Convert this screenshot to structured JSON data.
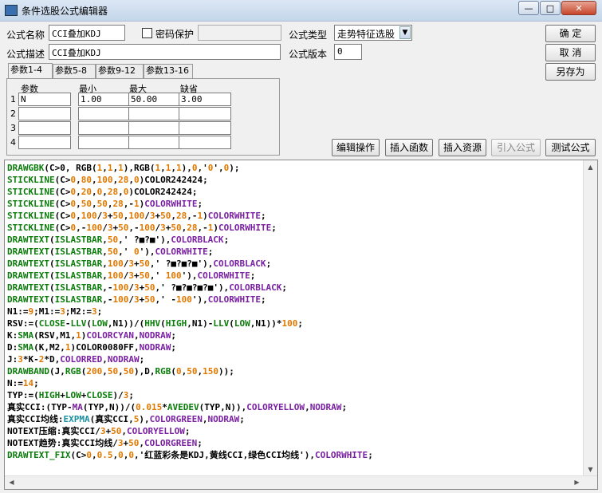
{
  "window": {
    "title": "条件选股公式编辑器",
    "minimize": "—",
    "maximize": "□",
    "close": "✕"
  },
  "form": {
    "name_label": "公式名称",
    "name_value": "CCI叠加KDJ",
    "password_label": "密码保护",
    "password_value": "",
    "type_label": "公式类型",
    "type_value": "走势特征选股",
    "desc_label": "公式描述",
    "desc_value": "CCI叠加KDJ",
    "version_label": "公式版本",
    "version_value": "0"
  },
  "buttons": {
    "ok": "确  定",
    "cancel": "取  消",
    "save_as": "另存为",
    "edit_op": "编辑操作",
    "insert_func": "插入函数",
    "insert_res": "插入资源",
    "import_formula": "引入公式",
    "test_formula": "测试公式"
  },
  "tabs": [
    "参数1-4",
    "参数5-8",
    "参数9-12",
    "参数13-16"
  ],
  "params": {
    "headers": [
      "参数",
      "最小",
      "最大",
      "缺省"
    ],
    "rows": [
      {
        "num": "1",
        "name": "N",
        "min": "1.00",
        "max": "50.00",
        "def": "3.00"
      },
      {
        "num": "2",
        "name": "",
        "min": "",
        "max": "",
        "def": ""
      },
      {
        "num": "3",
        "name": "",
        "min": "",
        "max": "",
        "def": ""
      },
      {
        "num": "4",
        "name": "",
        "min": "",
        "max": "",
        "def": ""
      }
    ]
  },
  "colors": {
    "func_green": "#0a7d0a",
    "keyword_purple": "#7a1fa2",
    "number_orange": "#e07800",
    "cyan_func": "#1a8fa0",
    "text_black": "#000000"
  },
  "code_lines": [
    [
      [
        "DRAWGBK",
        "g"
      ],
      [
        "(C>0, RGB(",
        "k"
      ],
      [
        "1",
        "o"
      ],
      [
        ",",
        "k"
      ],
      [
        "1",
        "o"
      ],
      [
        ",",
        "k"
      ],
      [
        "1",
        "o"
      ],
      [
        "),RGB(",
        "k"
      ],
      [
        "1",
        "o"
      ],
      [
        ",",
        "k"
      ],
      [
        "1",
        "o"
      ],
      [
        ",",
        "k"
      ],
      [
        "1",
        "o"
      ],
      [
        "),",
        "k"
      ],
      [
        "0",
        "o"
      ],
      [
        ",'",
        "k"
      ],
      [
        "0",
        "o"
      ],
      [
        "',",
        "k"
      ],
      [
        "0",
        "o"
      ],
      [
        ");",
        "k"
      ]
    ],
    [
      [
        "STICKLINE",
        "g"
      ],
      [
        "(C>",
        "k"
      ],
      [
        "0",
        "o"
      ],
      [
        ",",
        "k"
      ],
      [
        "80",
        "o"
      ],
      [
        ",",
        "k"
      ],
      [
        "100",
        "o"
      ],
      [
        ",",
        "k"
      ],
      [
        "28",
        "o"
      ],
      [
        ",",
        "k"
      ],
      [
        "0",
        "o"
      ],
      [
        ")COLOR242424;",
        "k"
      ]
    ],
    [
      [
        "STICKLINE",
        "g"
      ],
      [
        "(C>",
        "k"
      ],
      [
        "0",
        "o"
      ],
      [
        ",",
        "k"
      ],
      [
        "20",
        "o"
      ],
      [
        ",",
        "k"
      ],
      [
        "0",
        "o"
      ],
      [
        ",",
        "k"
      ],
      [
        "28",
        "o"
      ],
      [
        ",",
        "k"
      ],
      [
        "0",
        "o"
      ],
      [
        ")COLOR242424;",
        "k"
      ]
    ],
    [
      [
        "STICKLINE",
        "g"
      ],
      [
        "(C>",
        "k"
      ],
      [
        "0",
        "o"
      ],
      [
        ",",
        "k"
      ],
      [
        "50",
        "o"
      ],
      [
        ",",
        "k"
      ],
      [
        "50",
        "o"
      ],
      [
        ",",
        "k"
      ],
      [
        "28",
        "o"
      ],
      [
        ",-",
        "k"
      ],
      [
        "1",
        "o"
      ],
      [
        ")",
        "k"
      ],
      [
        "COLORWHITE",
        "p"
      ],
      [
        ";",
        "k"
      ]
    ],
    [
      [
        "STICKLINE",
        "g"
      ],
      [
        "(C>",
        "k"
      ],
      [
        "0",
        "o"
      ],
      [
        ",",
        "k"
      ],
      [
        "100",
        "o"
      ],
      [
        "/",
        "k"
      ],
      [
        "3",
        "o"
      ],
      [
        "+",
        "k"
      ],
      [
        "50",
        "o"
      ],
      [
        ",",
        "k"
      ],
      [
        "100",
        "o"
      ],
      [
        "/",
        "k"
      ],
      [
        "3",
        "o"
      ],
      [
        "+",
        "k"
      ],
      [
        "50",
        "o"
      ],
      [
        ",",
        "k"
      ],
      [
        "28",
        "o"
      ],
      [
        ",-",
        "k"
      ],
      [
        "1",
        "o"
      ],
      [
        ")",
        "k"
      ],
      [
        "COLORWHITE",
        "p"
      ],
      [
        ";",
        "k"
      ]
    ],
    [
      [
        "STICKLINE",
        "g"
      ],
      [
        "(C>",
        "k"
      ],
      [
        "0",
        "o"
      ],
      [
        ",-",
        "k"
      ],
      [
        "100",
        "o"
      ],
      [
        "/",
        "k"
      ],
      [
        "3",
        "o"
      ],
      [
        "+",
        "k"
      ],
      [
        "50",
        "o"
      ],
      [
        ",-",
        "k"
      ],
      [
        "100",
        "o"
      ],
      [
        "/",
        "k"
      ],
      [
        "3",
        "o"
      ],
      [
        "+",
        "k"
      ],
      [
        "50",
        "o"
      ],
      [
        ",",
        "k"
      ],
      [
        "28",
        "o"
      ],
      [
        ",-",
        "k"
      ],
      [
        "1",
        "o"
      ],
      [
        ")",
        "k"
      ],
      [
        "COLORWHITE",
        "p"
      ],
      [
        ";",
        "k"
      ]
    ],
    [
      [
        "DRAWTEXT",
        "g"
      ],
      [
        "(",
        "k"
      ],
      [
        "ISLASTBAR",
        "g"
      ],
      [
        ",",
        "k"
      ],
      [
        "50",
        "o"
      ],
      [
        ",' ?■?■'),",
        "k"
      ],
      [
        "COLORBLACK",
        "p"
      ],
      [
        ";",
        "k"
      ]
    ],
    [
      [
        "DRAWTEXT",
        "g"
      ],
      [
        "(",
        "k"
      ],
      [
        "ISLASTBAR",
        "g"
      ],
      [
        ",",
        "k"
      ],
      [
        "50",
        "o"
      ],
      [
        ",' ",
        "k"
      ],
      [
        "0",
        "o"
      ],
      [
        "'),",
        "k"
      ],
      [
        "COLORWHITE",
        "p"
      ],
      [
        ";",
        "k"
      ]
    ],
    [
      [
        "DRAWTEXT",
        "g"
      ],
      [
        "(",
        "k"
      ],
      [
        "ISLASTBAR",
        "g"
      ],
      [
        ",",
        "k"
      ],
      [
        "100",
        "o"
      ],
      [
        "/",
        "k"
      ],
      [
        "3",
        "o"
      ],
      [
        "+",
        "k"
      ],
      [
        "50",
        "o"
      ],
      [
        ",' ?■?■?■'),",
        "k"
      ],
      [
        "COLORBLACK",
        "p"
      ],
      [
        ";",
        "k"
      ]
    ],
    [
      [
        "DRAWTEXT",
        "g"
      ],
      [
        "(",
        "k"
      ],
      [
        "ISLASTBAR",
        "g"
      ],
      [
        ",",
        "k"
      ],
      [
        "100",
        "o"
      ],
      [
        "/",
        "k"
      ],
      [
        "3",
        "o"
      ],
      [
        "+",
        "k"
      ],
      [
        "50",
        "o"
      ],
      [
        ",' ",
        "k"
      ],
      [
        "100",
        "o"
      ],
      [
        "'),",
        "k"
      ],
      [
        "COLORWHITE",
        "p"
      ],
      [
        ";",
        "k"
      ]
    ],
    [
      [
        "DRAWTEXT",
        "g"
      ],
      [
        "(",
        "k"
      ],
      [
        "ISLASTBAR",
        "g"
      ],
      [
        ",-",
        "k"
      ],
      [
        "100",
        "o"
      ],
      [
        "/",
        "k"
      ],
      [
        "3",
        "o"
      ],
      [
        "+",
        "k"
      ],
      [
        "50",
        "o"
      ],
      [
        ",' ?■?■?■?■'),",
        "k"
      ],
      [
        "COLORBLACK",
        "p"
      ],
      [
        ";",
        "k"
      ]
    ],
    [
      [
        "DRAWTEXT",
        "g"
      ],
      [
        "(",
        "k"
      ],
      [
        "ISLASTBAR",
        "g"
      ],
      [
        ",-",
        "k"
      ],
      [
        "100",
        "o"
      ],
      [
        "/",
        "k"
      ],
      [
        "3",
        "o"
      ],
      [
        "+",
        "k"
      ],
      [
        "50",
        "o"
      ],
      [
        ",' -",
        "k"
      ],
      [
        "100",
        "o"
      ],
      [
        "'),",
        "k"
      ],
      [
        "COLORWHITE",
        "p"
      ],
      [
        ";",
        "k"
      ]
    ],
    [
      [
        "N1:=",
        "k"
      ],
      [
        "9",
        "o"
      ],
      [
        ";M1:=",
        "k"
      ],
      [
        "3",
        "o"
      ],
      [
        ";M2:=",
        "k"
      ],
      [
        "3",
        "o"
      ],
      [
        ";",
        "k"
      ]
    ],
    [
      [
        "RSV:=(",
        "k"
      ],
      [
        "CLOSE",
        "g"
      ],
      [
        "-",
        "k"
      ],
      [
        "LLV",
        "g"
      ],
      [
        "(",
        "k"
      ],
      [
        "LOW",
        "g"
      ],
      [
        ",N1))/(",
        "k"
      ],
      [
        "HHV",
        "g"
      ],
      [
        "(",
        "k"
      ],
      [
        "HIGH",
        "g"
      ],
      [
        ",N1)-",
        "k"
      ],
      [
        "LLV",
        "g"
      ],
      [
        "(",
        "k"
      ],
      [
        "LOW",
        "g"
      ],
      [
        ",N1))*",
        "k"
      ],
      [
        "100",
        "o"
      ],
      [
        ";",
        "k"
      ]
    ],
    [
      [
        "K:",
        "k"
      ],
      [
        "SMA",
        "g"
      ],
      [
        "(RSV,M1,",
        "k"
      ],
      [
        "1",
        "o"
      ],
      [
        ")",
        "k"
      ],
      [
        "COLORCYAN",
        "p"
      ],
      [
        ",",
        "k"
      ],
      [
        "NODRAW",
        "p"
      ],
      [
        ";",
        "k"
      ]
    ],
    [
      [
        "D:",
        "k"
      ],
      [
        "SMA",
        "g"
      ],
      [
        "(K,M2,",
        "k"
      ],
      [
        "1",
        "o"
      ],
      [
        ")COLOR0080FF,",
        "k"
      ],
      [
        "NODRAW",
        "p"
      ],
      [
        ";",
        "k"
      ]
    ],
    [
      [
        "J:",
        "k"
      ],
      [
        "3",
        "o"
      ],
      [
        "*K-",
        "k"
      ],
      [
        "2",
        "o"
      ],
      [
        "*D,",
        "k"
      ],
      [
        "COLORRED",
        "p"
      ],
      [
        ",",
        "k"
      ],
      [
        "NODRAW",
        "p"
      ],
      [
        ";",
        "k"
      ]
    ],
    [
      [
        "DRAWBAND",
        "g"
      ],
      [
        "(J,",
        "k"
      ],
      [
        "RGB",
        "g"
      ],
      [
        "(",
        "k"
      ],
      [
        "200",
        "o"
      ],
      [
        ",",
        "k"
      ],
      [
        "50",
        "o"
      ],
      [
        ",",
        "k"
      ],
      [
        "50",
        "o"
      ],
      [
        "),D,",
        "k"
      ],
      [
        "RGB",
        "g"
      ],
      [
        "(",
        "k"
      ],
      [
        "0",
        "o"
      ],
      [
        ",",
        "k"
      ],
      [
        "50",
        "o"
      ],
      [
        ",",
        "k"
      ],
      [
        "150",
        "o"
      ],
      [
        "));",
        "k"
      ]
    ],
    [
      [
        "N:=",
        "k"
      ],
      [
        "14",
        "o"
      ],
      [
        ";",
        "k"
      ]
    ],
    [
      [
        "TYP:=(",
        "k"
      ],
      [
        "HIGH",
        "g"
      ],
      [
        "+",
        "k"
      ],
      [
        "LOW",
        "g"
      ],
      [
        "+",
        "k"
      ],
      [
        "CLOSE",
        "g"
      ],
      [
        ")/",
        "k"
      ],
      [
        "3",
        "o"
      ],
      [
        ";",
        "k"
      ]
    ],
    [
      [
        "真实CCI:(TYP-",
        "k"
      ],
      [
        "MA",
        "p"
      ],
      [
        "(TYP,N))/(",
        "k"
      ],
      [
        "0.015",
        "o"
      ],
      [
        "*",
        "k"
      ],
      [
        "AVEDEV",
        "g"
      ],
      [
        "(TYP,N)),",
        "k"
      ],
      [
        "COLORYELLOW",
        "p"
      ],
      [
        ",",
        "k"
      ],
      [
        "NODRAW",
        "p"
      ],
      [
        ";",
        "k"
      ]
    ],
    [
      [
        "真实CCI均线:",
        "k"
      ],
      [
        "EXPMA",
        "c"
      ],
      [
        "(真实CCI,",
        "k"
      ],
      [
        "5",
        "o"
      ],
      [
        "),",
        "k"
      ],
      [
        "COLORGREEN",
        "p"
      ],
      [
        ",",
        "k"
      ],
      [
        "NODRAW",
        "p"
      ],
      [
        ";",
        "k"
      ]
    ],
    [
      [
        "NOTEXT压缩:真实CCI/",
        "k"
      ],
      [
        "3",
        "o"
      ],
      [
        "+",
        "k"
      ],
      [
        "50",
        "o"
      ],
      [
        ",",
        "k"
      ],
      [
        "COLORYELLOW",
        "p"
      ],
      [
        ";",
        "k"
      ]
    ],
    [
      [
        "NOTEXT趋势:真实CCI均线/",
        "k"
      ],
      [
        "3",
        "o"
      ],
      [
        "+",
        "k"
      ],
      [
        "50",
        "o"
      ],
      [
        ",",
        "k"
      ],
      [
        "COLORGREEN",
        "p"
      ],
      [
        ";",
        "k"
      ]
    ],
    [
      [
        "DRAWTEXT_FIX",
        "g"
      ],
      [
        "(C>",
        "k"
      ],
      [
        "0",
        "o"
      ],
      [
        ",",
        "k"
      ],
      [
        "0.5",
        "o"
      ],
      [
        ",",
        "k"
      ],
      [
        "0",
        "o"
      ],
      [
        ",",
        "k"
      ],
      [
        "0",
        "o"
      ],
      [
        ",'红蓝彩条是KDJ,黄线CCI,绿色CCI均线'),",
        "k"
      ],
      [
        "COLORWHITE",
        "p"
      ],
      [
        ";",
        "k"
      ]
    ]
  ]
}
